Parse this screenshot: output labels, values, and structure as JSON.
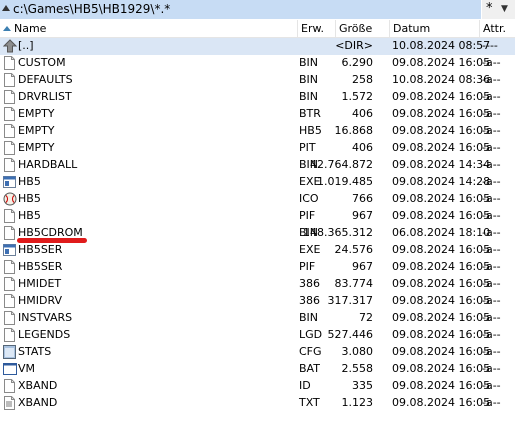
{
  "path": {
    "text": "c:\\Games\\HB5\\HB1929\\*.*",
    "history_label": "*"
  },
  "columns": {
    "name": "Name",
    "ext": "Erw.",
    "size": "Größe",
    "date": "Datum",
    "attr": "Attr."
  },
  "files": [
    {
      "name": "[..]",
      "ext": "",
      "size": "<DIR>",
      "date": "10.08.2024 08:57",
      "attr": "----",
      "icon": "parent-folder-icon"
    },
    {
      "name": "CUSTOM",
      "ext": "BIN",
      "size": "6.290",
      "date": "09.08.2024 16:05",
      "attr": "-a--",
      "icon": "file-icon"
    },
    {
      "name": "DEFAULTS",
      "ext": "BIN",
      "size": "258",
      "date": "10.08.2024 08:36",
      "attr": "-a--",
      "icon": "file-icon"
    },
    {
      "name": "DRVRLIST",
      "ext": "BIN",
      "size": "1.572",
      "date": "09.08.2024 16:05",
      "attr": "-a--",
      "icon": "file-icon"
    },
    {
      "name": "EMPTY",
      "ext": "BTR",
      "size": "406",
      "date": "09.08.2024 16:05",
      "attr": "-a--",
      "icon": "file-icon"
    },
    {
      "name": "EMPTY",
      "ext": "HB5",
      "size": "16.868",
      "date": "09.08.2024 16:05",
      "attr": "-a--",
      "icon": "file-icon"
    },
    {
      "name": "EMPTY",
      "ext": "PIT",
      "size": "406",
      "date": "09.08.2024 16:05",
      "attr": "-a--",
      "icon": "file-icon"
    },
    {
      "name": "HARDBALL",
      "ext": "BIN",
      "size": "42.764.872",
      "date": "09.08.2024 14:34",
      "attr": "-a--",
      "icon": "file-icon"
    },
    {
      "name": "HB5",
      "ext": "EXE",
      "size": "1.019.485",
      "date": "09.08.2024 14:28",
      "attr": "-a--",
      "icon": "exe-icon"
    },
    {
      "name": "HB5",
      "ext": "ICO",
      "size": "766",
      "date": "09.08.2024 16:05",
      "attr": "-a--",
      "icon": "baseball-icon"
    },
    {
      "name": "HB5",
      "ext": "PIF",
      "size": "967",
      "date": "09.08.2024 16:05",
      "attr": "-a--",
      "icon": "file-icon"
    },
    {
      "name": "HB5CDROM",
      "ext": "BIN",
      "size": "148.365.312",
      "date": "06.08.2024 18:10",
      "attr": "-a--",
      "icon": "file-icon"
    },
    {
      "name": "HB5SER",
      "ext": "EXE",
      "size": "24.576",
      "date": "09.08.2024 16:05",
      "attr": "-a--",
      "icon": "exe-icon"
    },
    {
      "name": "HB5SER",
      "ext": "PIF",
      "size": "967",
      "date": "09.08.2024 16:05",
      "attr": "-a--",
      "icon": "file-icon"
    },
    {
      "name": "HMIDET",
      "ext": "386",
      "size": "83.774",
      "date": "09.08.2024 16:05",
      "attr": "-a--",
      "icon": "file-icon"
    },
    {
      "name": "HMIDRV",
      "ext": "386",
      "size": "317.317",
      "date": "09.08.2024 16:05",
      "attr": "-a--",
      "icon": "file-icon"
    },
    {
      "name": "INSTVARS",
      "ext": "BIN",
      "size": "72",
      "date": "09.08.2024 16:05",
      "attr": "-a--",
      "icon": "file-icon"
    },
    {
      "name": "LEGENDS",
      "ext": "LGD",
      "size": "527.446",
      "date": "09.08.2024 16:05",
      "attr": "-a--",
      "icon": "file-icon"
    },
    {
      "name": "STATS",
      "ext": "CFG",
      "size": "3.080",
      "date": "09.08.2024 16:05",
      "attr": "-a--",
      "icon": "config-icon"
    },
    {
      "name": "VM",
      "ext": "BAT",
      "size": "2.558",
      "date": "09.08.2024 16:05",
      "attr": "-a--",
      "icon": "batch-icon"
    },
    {
      "name": "XBAND",
      "ext": "ID",
      "size": "335",
      "date": "09.08.2024 16:05",
      "attr": "-a--",
      "icon": "file-icon"
    },
    {
      "name": "XBAND",
      "ext": "TXT",
      "size": "1.123",
      "date": "09.08.2024 16:05",
      "attr": "-a--",
      "icon": "text-file-icon"
    }
  ],
  "annotation": {
    "color": "#e01b1b",
    "target": "HB5CDROM.BIN"
  }
}
